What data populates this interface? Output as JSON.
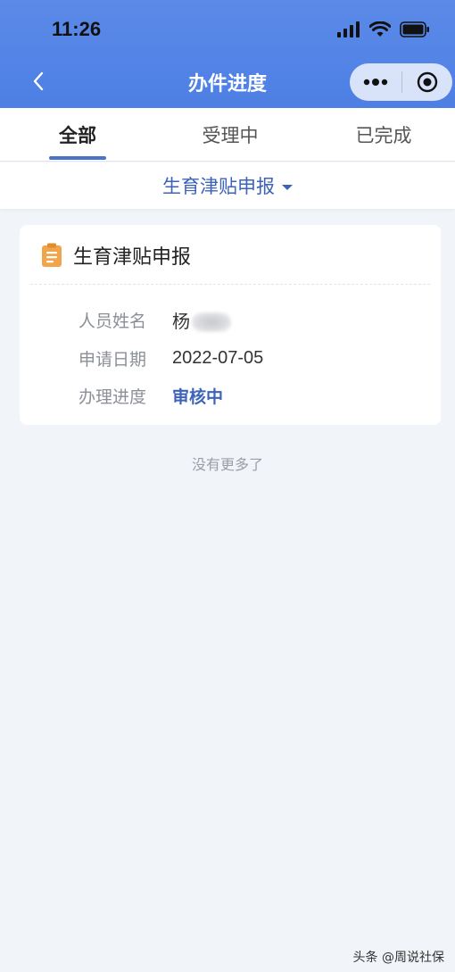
{
  "status_bar": {
    "time": "11:26"
  },
  "nav": {
    "title": "办件进度"
  },
  "tabs": [
    {
      "label": "全部",
      "active": true
    },
    {
      "label": "受理中",
      "active": false
    },
    {
      "label": "已完成",
      "active": false
    }
  ],
  "filter": {
    "label": "生育津贴申报"
  },
  "card": {
    "title": "生育津贴申报",
    "rows": [
      {
        "label": "人员姓名",
        "value": "杨"
      },
      {
        "label": "申请日期",
        "value": "2022-07-05"
      },
      {
        "label": "办理进度",
        "value": "审核中"
      }
    ]
  },
  "footer_text": "没有更多了",
  "watermark": "头条 @周说社保",
  "colors": {
    "header": "#4d7fe4",
    "accent": "#3d63b8",
    "background": "#f1f4f9",
    "doc_icon": "#f0a54a"
  },
  "icons": [
    "signal-icon",
    "wifi-icon",
    "battery-icon",
    "back-icon",
    "more-icon",
    "target-icon",
    "document-icon",
    "caret-down-icon"
  ]
}
